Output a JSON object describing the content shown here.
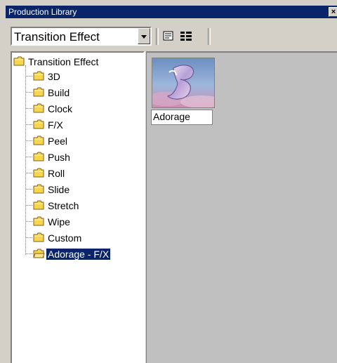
{
  "window": {
    "title": "Production Library",
    "close_label": "×"
  },
  "toolbar": {
    "category_value": "Transition Effect",
    "buttons": [
      {
        "icon": "details-view-icon"
      },
      {
        "icon": "list-view-icon"
      }
    ]
  },
  "tree": {
    "root": {
      "label": "Transition Effect",
      "icon": "folder-icon"
    },
    "children": [
      {
        "label": "3D",
        "icon": "folder-icon"
      },
      {
        "label": "Build",
        "icon": "folder-icon"
      },
      {
        "label": "Clock",
        "icon": "folder-icon"
      },
      {
        "label": "F/X",
        "icon": "folder-icon"
      },
      {
        "label": "Peel",
        "icon": "folder-icon"
      },
      {
        "label": "Push",
        "icon": "folder-icon"
      },
      {
        "label": "Roll",
        "icon": "folder-icon"
      },
      {
        "label": "Slide",
        "icon": "folder-icon"
      },
      {
        "label": "Stretch",
        "icon": "folder-icon"
      },
      {
        "label": "Wipe",
        "icon": "folder-icon"
      },
      {
        "label": "Custom",
        "icon": "folder-icon"
      },
      {
        "label": "Adorage - F/X",
        "icon": "open-folder-icon",
        "selected": true
      }
    ]
  },
  "content": {
    "items": [
      {
        "label": "Adorage",
        "icon": "adorage-thumbnail"
      }
    ]
  },
  "colors": {
    "titlebar": "#0a246a",
    "selection": "#0a246a",
    "folder": "#f5d64c",
    "face": "#d4d0c8",
    "pane": "#c0c0c0"
  }
}
